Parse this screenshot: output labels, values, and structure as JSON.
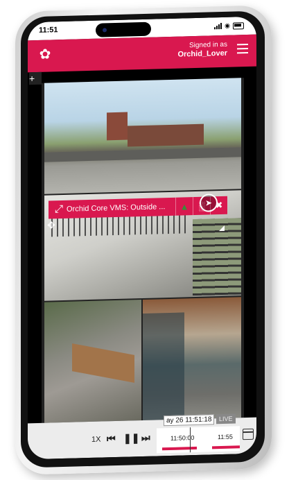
{
  "status_bar": {
    "time": "11:51"
  },
  "header": {
    "signed_in_label": "Signed in as",
    "username": "Orchid_Lover",
    "logo_icon": "orchid-logo-icon",
    "menu_icon": "hamburger-menu-icon",
    "accent_color": "#d9184f"
  },
  "add_tile_icon": "+",
  "active_tile": {
    "title": "Orchid Core VMS: Outside ...",
    "buttons": [
      "expand-icon",
      "turtle-speed-icon",
      "analytics-icon",
      "close-icon"
    ]
  },
  "timeline": {
    "speed": "1X",
    "cursor_time": "ay 26 11:51:18",
    "live_label": "LIVE",
    "tick_1": "11:50:00",
    "tick_2": "11:55"
  }
}
